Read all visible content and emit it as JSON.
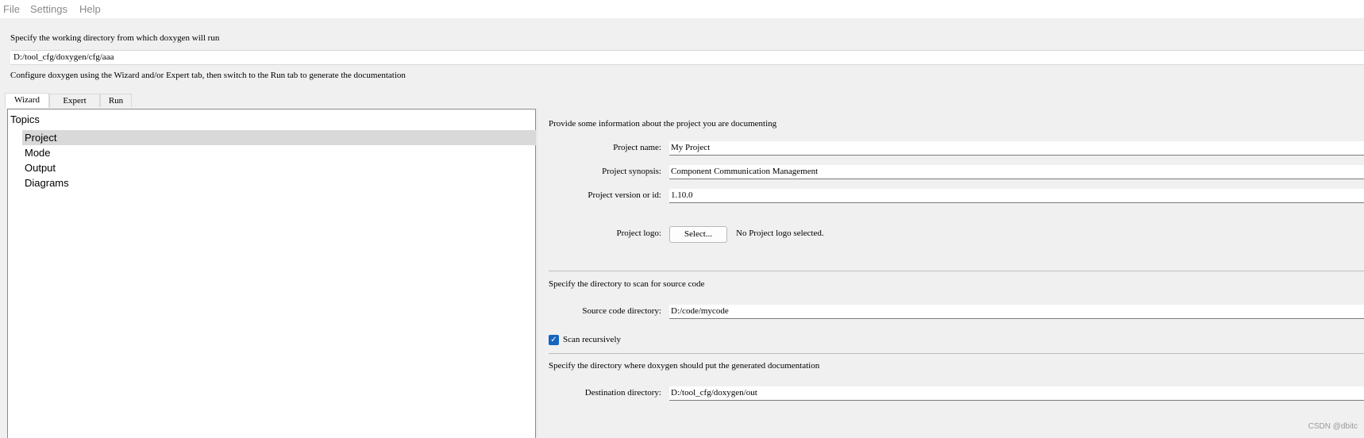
{
  "menu": {
    "items": [
      "File",
      "Settings",
      "Help"
    ]
  },
  "working_dir": {
    "instruction": "Specify the working directory from which doxygen will run",
    "value": "D:/tool_cfg/doxygen/cfg/aaa"
  },
  "configure_instruction": "Configure doxygen using the Wizard and/or Expert tab, then switch to the Run tab to generate the documentation",
  "tabs": [
    {
      "label": "Wizard",
      "active": true
    },
    {
      "label": "Expert",
      "active": false
    },
    {
      "label": "Run",
      "active": false
    }
  ],
  "topics": {
    "title": "Topics",
    "items": [
      "Project",
      "Mode",
      "Output",
      "Diagrams"
    ],
    "selected": "Project"
  },
  "project": {
    "intro": "Provide some information about the project you are documenting",
    "name_label": "Project name:",
    "name_value": "My Project",
    "synopsis_label": "Project synopsis:",
    "synopsis_value": "Component Communication Management",
    "version_label": "Project version or id:",
    "version_value": "1.10.0",
    "logo_label": "Project logo:",
    "logo_button": "Select...",
    "logo_status": "No Project logo selected."
  },
  "source": {
    "intro": "Specify the directory to scan for source code",
    "dir_label": "Source code directory:",
    "dir_value": "D:/code/mycode",
    "scan_recursively_label": "Scan recursively",
    "scan_recursively_checked": true,
    "checkmark_icon": "checkmark-icon"
  },
  "destination": {
    "intro": "Specify the directory where doxygen should put the generated documentation",
    "dir_label": "Destination directory:",
    "dir_value": "D:/tool_cfg/doxygen/out"
  },
  "watermark": "CSDN @dbitc",
  "colors": {
    "checkbox": "#1565c0",
    "selection": "#d9d9d9"
  }
}
